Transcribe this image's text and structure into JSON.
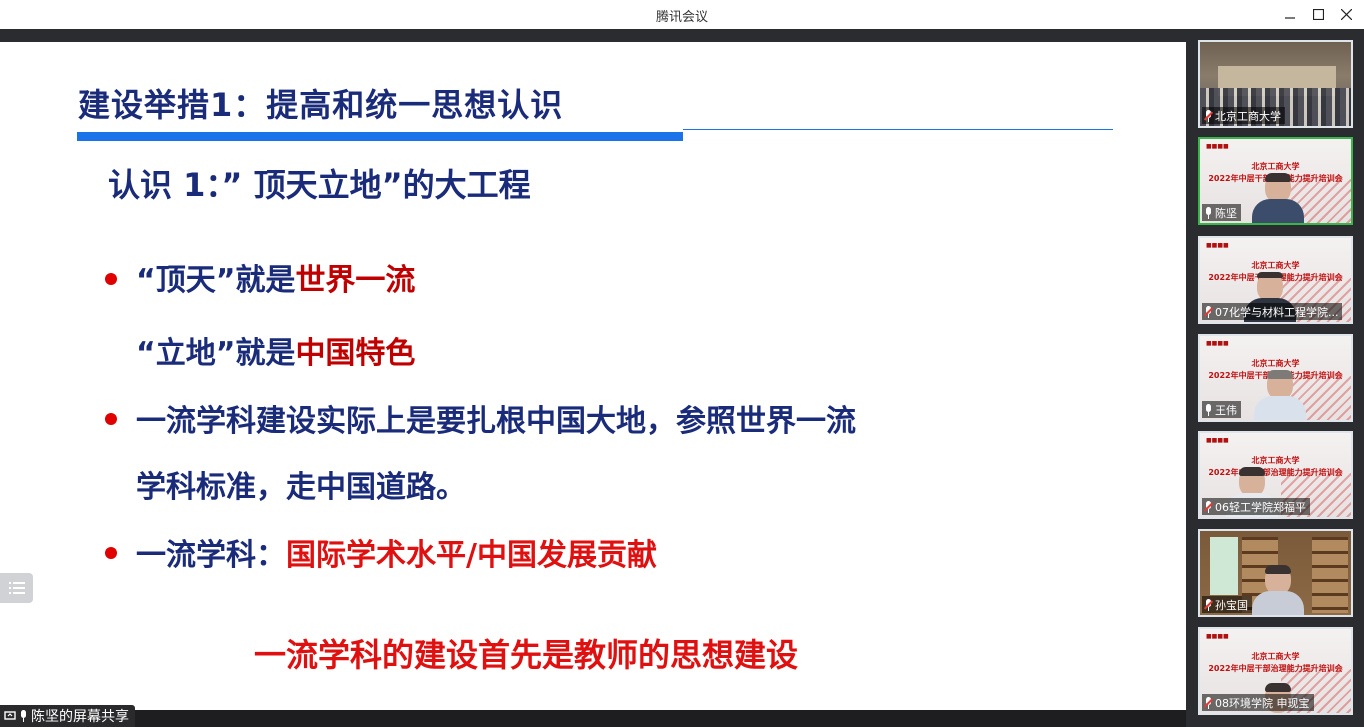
{
  "window": {
    "title": "腾讯会议",
    "controls": [
      "minimize",
      "maximize",
      "close"
    ]
  },
  "slide": {
    "title": "建设举措1：提高和统一思想认识",
    "subtitle": "认识 1：” 顶天立地”的大工程",
    "point1_a_prefix": "“顶天”就是",
    "point1_a_highlight": "世界一流",
    "point1_b_prefix": "“立地”就是",
    "point1_b_highlight": "中国特色",
    "point2_line1": "一流学科建设实际上是要扎根中国大地，参照世界一流",
    "point2_line2": "学科标准，走中国道路。",
    "point3_prefix": "一流学科：",
    "point3_highlight": "国际学术水平/中国发展贡献",
    "conclusion": "一流学科的建设首先是教师的思想建设"
  },
  "share": {
    "label": "陈坚的屏幕共享"
  },
  "banner": {
    "line1": "北京工商大学",
    "line2": "2022年中层干部治理能力提升培训会"
  },
  "participants": [
    {
      "name": "北京工商大学",
      "muted": true,
      "video": "room"
    },
    {
      "name": "陈坚",
      "muted": false,
      "video": "banner",
      "active": true
    },
    {
      "name": "07化学与材料工程学院...",
      "muted": true,
      "video": "banner"
    },
    {
      "name": "王伟",
      "muted": false,
      "video": "banner"
    },
    {
      "name": "06轻工学院郑福平",
      "muted": true,
      "video": "banner"
    },
    {
      "name": "孙宝国",
      "muted": true,
      "video": "library"
    },
    {
      "name": "08环境学院 申现宝",
      "muted": true,
      "video": "banner"
    }
  ],
  "colors": {
    "title_blue": "#1a2b7a",
    "accent_blue": "#1a73e8",
    "highlight_red": "#c00000",
    "speaking_green": "#39b54a"
  }
}
